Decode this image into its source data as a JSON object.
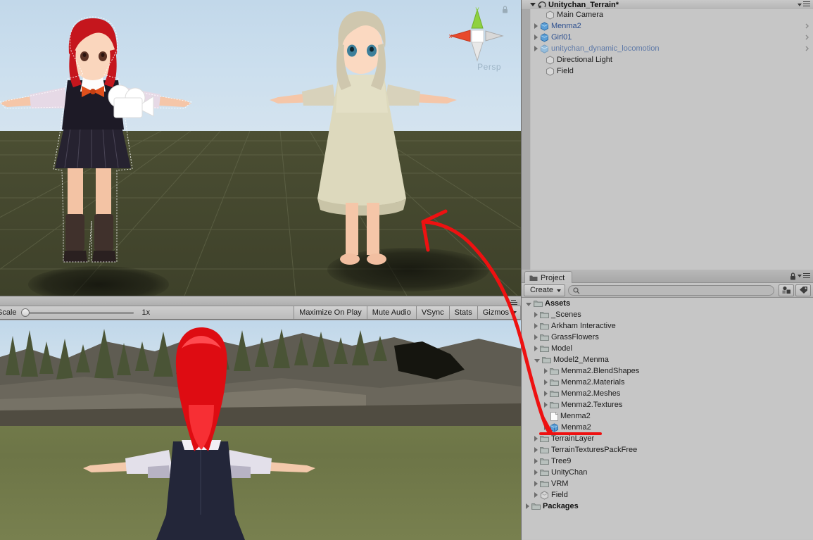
{
  "scene_view": {
    "name": "Scene View",
    "gizmo": {
      "x_axis": "x",
      "y_axis": "y",
      "projection_label": "Persp"
    },
    "camera_gizmo_icon": "camera-icon",
    "lock_icon": "lock-icon"
  },
  "game_toolbar": {
    "scale_label": "Scale",
    "scale_value": "1x",
    "buttons": [
      {
        "label": "Maximize On Play",
        "name": "maximize-on-play-button",
        "dropdown": false
      },
      {
        "label": "Mute Audio",
        "name": "mute-audio-button",
        "dropdown": false
      },
      {
        "label": "VSync",
        "name": "vsync-button",
        "dropdown": false
      },
      {
        "label": "Stats",
        "name": "stats-button",
        "dropdown": false
      },
      {
        "label": "Gizmos",
        "name": "gizmos-button",
        "dropdown": true
      }
    ]
  },
  "hierarchy": {
    "scene_name": "Unitychan_Terrain*",
    "items": [
      {
        "label": "Main Camera",
        "indent": 2,
        "expandable": false,
        "icon": "gameobject-icon",
        "style": "normal",
        "prefab_chevron": false
      },
      {
        "label": "Menma2",
        "indent": 1,
        "expandable": true,
        "icon": "prefab-icon",
        "style": "prefab",
        "prefab_chevron": true
      },
      {
        "label": "Girl01",
        "indent": 1,
        "expandable": true,
        "icon": "prefab-icon",
        "style": "prefab",
        "prefab_chevron": true
      },
      {
        "label": "unitychan_dynamic_locomotion",
        "indent": 1,
        "expandable": true,
        "icon": "prefab-icon-dim",
        "style": "prefab-dim",
        "prefab_chevron": true
      },
      {
        "label": "Directional Light",
        "indent": 2,
        "expandable": false,
        "icon": "gameobject-icon",
        "style": "normal",
        "prefab_chevron": false
      },
      {
        "label": "Field",
        "indent": 2,
        "expandable": false,
        "icon": "gameobject-icon",
        "style": "normal",
        "prefab_chevron": false
      }
    ]
  },
  "project": {
    "tab_label": "Project",
    "tab_icon": "folder-icon",
    "create_label": "Create",
    "search_placeholder": "",
    "search_value": "",
    "lock_icon": "lock-icon",
    "filter_type_icon": "filter-by-type-icon",
    "filter_label_icon": "filter-by-label-icon",
    "items": [
      {
        "label": "Assets",
        "indent": 0,
        "state": "open",
        "icon": "folder-icon",
        "bold": true,
        "underline": false
      },
      {
        "label": "_Scenes",
        "indent": 1,
        "state": "closed",
        "icon": "folder-icon",
        "bold": false,
        "underline": false
      },
      {
        "label": "Arkham Interactive",
        "indent": 1,
        "state": "closed",
        "icon": "folder-icon",
        "bold": false,
        "underline": false
      },
      {
        "label": "GrassFlowers",
        "indent": 1,
        "state": "closed",
        "icon": "folder-icon",
        "bold": false,
        "underline": false
      },
      {
        "label": "Model",
        "indent": 1,
        "state": "closed",
        "icon": "folder-icon",
        "bold": false,
        "underline": false
      },
      {
        "label": "Model2_Menma",
        "indent": 1,
        "state": "open",
        "icon": "folder-icon",
        "bold": false,
        "underline": false
      },
      {
        "label": "Menma2.BlendShapes",
        "indent": 2,
        "state": "closed",
        "icon": "folder-icon",
        "bold": false,
        "underline": false
      },
      {
        "label": "Menma2.Materials",
        "indent": 2,
        "state": "closed",
        "icon": "folder-icon",
        "bold": false,
        "underline": false
      },
      {
        "label": "Menma2.Meshes",
        "indent": 2,
        "state": "closed",
        "icon": "folder-icon",
        "bold": false,
        "underline": false
      },
      {
        "label": "Menma2.Textures",
        "indent": 2,
        "state": "closed",
        "icon": "folder-icon",
        "bold": false,
        "underline": false
      },
      {
        "label": "Menma2",
        "indent": 2,
        "state": "leaf",
        "icon": "document-icon",
        "bold": false,
        "underline": false
      },
      {
        "label": "Menma2",
        "indent": 2,
        "state": "closed",
        "icon": "prefab-icon",
        "bold": false,
        "underline": true
      },
      {
        "label": "TerrainLayer",
        "indent": 1,
        "state": "closed",
        "icon": "folder-icon",
        "bold": false,
        "underline": false
      },
      {
        "label": "TerrainTexturesPackFree",
        "indent": 1,
        "state": "closed",
        "icon": "folder-icon",
        "bold": false,
        "underline": false
      },
      {
        "label": "Tree9",
        "indent": 1,
        "state": "closed",
        "icon": "folder-icon",
        "bold": false,
        "underline": false
      },
      {
        "label": "UnityChan",
        "indent": 1,
        "state": "closed",
        "icon": "folder-icon",
        "bold": false,
        "underline": false
      },
      {
        "label": "VRM",
        "indent": 1,
        "state": "closed",
        "icon": "folder-icon",
        "bold": false,
        "underline": false
      },
      {
        "label": "Field",
        "indent": 1,
        "state": "closed",
        "icon": "prefab-gray-icon",
        "bold": false,
        "underline": false
      },
      {
        "label": "Packages",
        "indent": 0,
        "state": "closed",
        "icon": "folder-icon",
        "bold": true,
        "underline": false
      }
    ]
  },
  "annotation": {
    "color": "#ee1111",
    "description": "red arrow from Menma2 prefab in Project panel to the scene view"
  }
}
